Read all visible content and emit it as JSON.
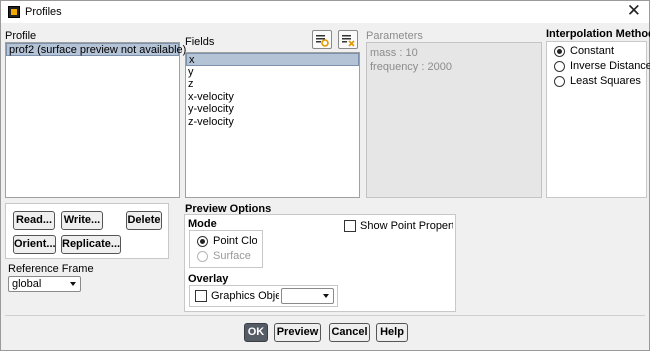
{
  "window": {
    "title": "Profiles",
    "close_glyph": "✕"
  },
  "profile": {
    "label": "Profile",
    "items": [
      "prof2 (surface preview not available)"
    ]
  },
  "fields": {
    "label": "Fields",
    "items": [
      "x",
      "y",
      "z",
      "x-velocity",
      "y-velocity",
      "z-velocity"
    ],
    "select_all_icon": "select-all-icon",
    "deselect_all_icon": "deselect-all-icon"
  },
  "parameters": {
    "label": "Parameters",
    "items": [
      "mass : 10",
      "frequency : 2000"
    ]
  },
  "interpolation": {
    "label": "Interpolation Method",
    "options": [
      "Constant",
      "Inverse Distance",
      "Least Squares"
    ],
    "selected": "Constant"
  },
  "actions": {
    "read": "Read...",
    "write": "Write...",
    "delete": "Delete",
    "orient": "Orient...",
    "replicate": "Replicate..."
  },
  "reference_frame": {
    "label": "Reference Frame",
    "value": "global"
  },
  "preview_options": {
    "label": "Preview Options",
    "mode_label": "Mode",
    "modes": [
      "Point Cloud",
      "Surface"
    ],
    "selected_mode": "Point Cloud",
    "show_point_properties": "Show Point Properties",
    "overlay_label": "Overlay",
    "graphics_objects": "Graphics Objects",
    "graphics_value": ""
  },
  "footer": {
    "ok": "OK",
    "preview": "Preview",
    "cancel": "Cancel",
    "help": "Help"
  }
}
